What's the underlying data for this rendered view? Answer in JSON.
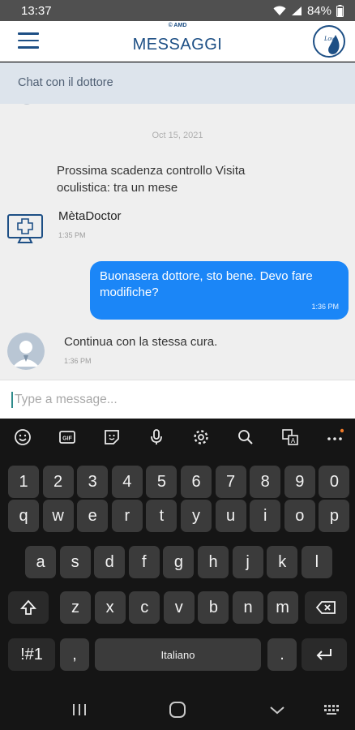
{
  "status_bar": {
    "time": "13:37",
    "battery": "84%",
    "icons": [
      "wifi-icon",
      "signal-icon",
      "battery-icon"
    ]
  },
  "header": {
    "brand": "© AMD",
    "title": "MESSAGGI",
    "logo_text": "Low",
    "menu_icon": "hamburger-menu-icon"
  },
  "subheader": {
    "label": "Chat con il dottore"
  },
  "chat": {
    "date_separator": "Oct 15, 2021",
    "system_message": "Prossima scadenza controllo Visita oculistica: tra un mese",
    "sender_name": "MètaDoctor",
    "sender_time": "1:35 PM",
    "outgoing": {
      "text": "Buonasera dottore, sto bene. Devo fare modifiche?",
      "time": "1:36 PM"
    },
    "incoming": {
      "text": "Continua con la stessa cura.",
      "time": "1:36 PM"
    }
  },
  "input": {
    "placeholder": "Type a message..."
  },
  "keyboard": {
    "toolbar": [
      "emoji-icon",
      "gif-icon",
      "sticker-icon",
      "microphone-icon",
      "settings-gear-icon",
      "search-icon",
      "translate-icon",
      "more-icon"
    ],
    "row_numbers": [
      "1",
      "2",
      "3",
      "4",
      "5",
      "6",
      "7",
      "8",
      "9",
      "0"
    ],
    "row_top": [
      "q",
      "w",
      "e",
      "r",
      "t",
      "y",
      "u",
      "i",
      "o",
      "p"
    ],
    "row_mid": [
      "a",
      "s",
      "d",
      "f",
      "g",
      "h",
      "j",
      "k",
      "l"
    ],
    "row_bottom": [
      "z",
      "x",
      "c",
      "v",
      "b",
      "n",
      "m"
    ],
    "symbols_key": "!#1",
    "comma_key": ",",
    "space_label": "Italiano",
    "period_key": "."
  },
  "colors": {
    "primary": "#1d4f85",
    "bubble": "#1b86f7",
    "subheader_bg": "#dde4ec",
    "chat_bg": "#efefef"
  }
}
